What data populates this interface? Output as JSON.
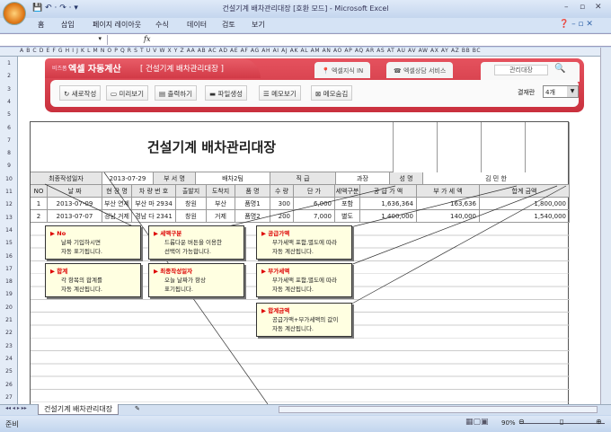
{
  "window": {
    "title": "건설기계 배차관리대장  [호환 모드] - Microsoft Excel"
  },
  "ribbon_tabs": [
    "홈",
    "삽입",
    "페이지 레이아웃",
    "수식",
    "데이터",
    "검토",
    "보기"
  ],
  "formula": {
    "fx": "fx"
  },
  "columns": "A B C D E F G H I J K L M N O P Q R S T U V W X Y Z AA AB AC AD AE AF AG AH AI AJ AK AL AM AN AO AP AQ AR AS AT AU AV AW AX AY AZ BB BC",
  "banner": {
    "brand_small": "비즈폼",
    "brand": "엑셀 자동계산",
    "doc_title": "[ 건설기계 배차관리대장 ]",
    "tab1": "엑셀지식 IN",
    "tab2": "엑셀상담 서비스",
    "search_value": "관리대장",
    "buttons": [
      "새로작성",
      "미리보기",
      "출력하기",
      "파일생성",
      "메모보기",
      "메모숨김"
    ],
    "result_label": "결재란",
    "result_value": "4개"
  },
  "doc": {
    "title": "건설기계 배차관리대장",
    "info": {
      "date_label": "최종작성일자",
      "date": "2013-07-29",
      "dept_label": "부 서 명",
      "dept": "배차2팀",
      "rank_label": "직 급",
      "rank": "과장",
      "name_label": "성 명",
      "name": "김 민 한"
    },
    "headers": [
      "NO",
      "날 짜",
      "현 장 명",
      "차 량 번 호",
      "출발지",
      "도착지",
      "품 명",
      "수 량",
      "단 가",
      "세액구분",
      "공 급 가 액",
      "부 가 세 액",
      "합계 금액"
    ],
    "rows": [
      [
        "1",
        "2013-07-09",
        "부산 연제",
        "부산 마 2934",
        "창원",
        "부산",
        "품명1",
        "300",
        "6,000",
        "포함",
        "1,636,364",
        "163,636",
        "1,800,000"
      ],
      [
        "2",
        "2013-07-07",
        "경남 거제",
        "경남 다 2341",
        "창원",
        "거제",
        "품명2",
        "200",
        "7,000",
        "별도",
        "1,400,000",
        "140,000",
        "1,540,000"
      ]
    ]
  },
  "notes": [
    {
      "title": "No",
      "body": [
        "날짜 기입하시면",
        "자동 표기됩니다."
      ]
    },
    {
      "title": "세액구분",
      "body": [
        "드롭다운 버튼을 이용한",
        "선택이 가능합니다."
      ]
    },
    {
      "title": "공급가액",
      "body": [
        "부가세액 포함,별도에 따라",
        "자동 계산됩니다."
      ]
    },
    {
      "title": "합계",
      "body": [
        "각 항목의 합계를",
        "자동 계산됩니다."
      ]
    },
    {
      "title": "최종작성일자",
      "body": [
        "오늘 날짜가 항상",
        "표기됩니다."
      ]
    },
    {
      "title": "부가세액",
      "body": [
        "부가세액 포함,별도에 따라",
        "자동 계산됩니다."
      ]
    },
    {
      "title": "합계금액",
      "body": [
        "공급가액+부가세액의 값이",
        "자동 계산됩니다."
      ]
    }
  ],
  "sheet_tab": "건설기계 배차관리대장",
  "status": {
    "ready": "준비",
    "zoom": "90%"
  }
}
